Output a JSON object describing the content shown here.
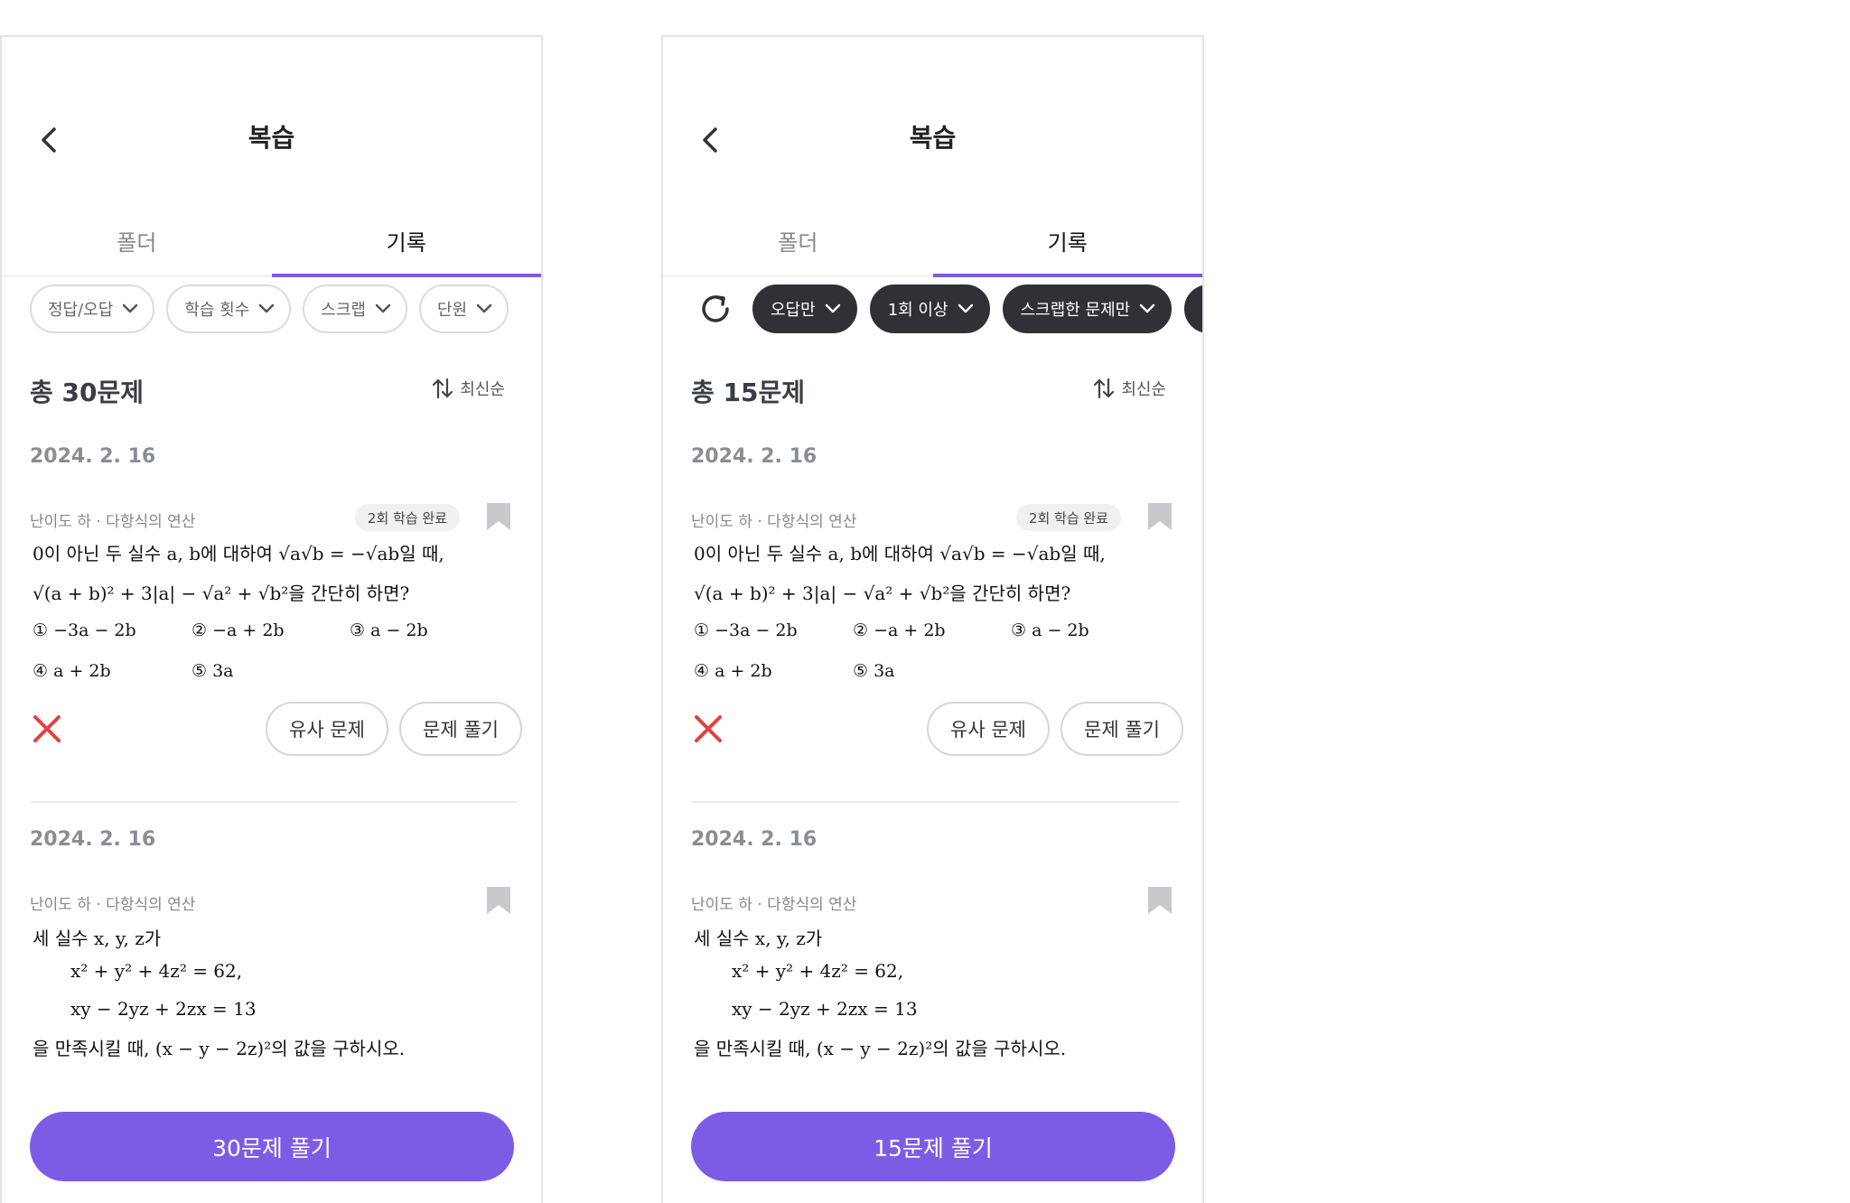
{
  "screens": [
    {
      "title": "복습",
      "tabs": [
        "폴더",
        "기록"
      ],
      "filters": [
        "정답/오답",
        "학습 횟수",
        "스크랩",
        "단원"
      ],
      "total": "총 30문제",
      "sort": "최신순",
      "items": [
        {
          "date": "2024. 2. 16",
          "meta": "난이도 하 · 다항식의 연산",
          "badge": "2회 학습 완료",
          "q_line1": "0이 아닌 두 실수 a, b에 대하여 √a√b = −√ab일 때,",
          "q_line2": "√(a + b)² + 3|a| − √a² + √b²을 간단히 하면?",
          "choices": [
            "① −3a − 2b",
            "② −a + 2b",
            "③ a − 2b",
            "④ a + 2b",
            "⑤ 3a"
          ],
          "similar": "유사 문제",
          "solve": "문제 풀기"
        },
        {
          "date": "2024. 2. 16",
          "meta": "난이도 하 · 다항식의 연산",
          "q_line1": "세 실수 x, y, z가",
          "q_line2": "x² + y² + 4z² = 62,",
          "q_line3": "xy − 2yz + 2zx = 13",
          "q_line4": "을 만족시킬 때, (x − y − 2z)²의 값을 구하시오."
        }
      ],
      "cta": "30문제 풀기"
    },
    {
      "title": "복습",
      "tabs": [
        "폴더",
        "기록"
      ],
      "filters": [
        "오답만",
        "1회 이상",
        "스크랩한 문제만"
      ],
      "total": "총 15문제",
      "sort": "최신순",
      "items": [
        {
          "date": "2024. 2. 16",
          "meta": "난이도 하 · 다항식의 연산",
          "badge": "2회 학습 완료",
          "q_line1": "0이 아닌 두 실수 a, b에 대하여 √a√b = −√ab일 때,",
          "q_line2": "√(a + b)² + 3|a| − √a² + √b²을 간단히 하면?",
          "choices": [
            "① −3a − 2b",
            "② −a + 2b",
            "③ a − 2b",
            "④ a + 2b",
            "⑤ 3a"
          ],
          "similar": "유사 문제",
          "solve": "문제 풀기"
        },
        {
          "date": "2024. 2. 16",
          "meta": "난이도 하 · 다항식의 연산",
          "q_line1": "세 실수 x, y, z가",
          "q_line2": "x² + y² + 4z² = 62,",
          "q_line3": "xy − 2yz + 2zx = 13",
          "q_line4": "을 만족시킬 때, (x − y − 2z)²의 값을 구하시오."
        }
      ],
      "cta": "15문제 풀기"
    }
  ],
  "colors": {
    "accent": "#7d5ce5",
    "chip_dark": "#2f3136",
    "wrong": "#e5403c",
    "bookmark": "#c8c9cd"
  },
  "icons": [
    "back-arrow-icon",
    "chevron-down-icon",
    "sort-icon",
    "bookmark-icon",
    "wrong-x-icon",
    "refresh-icon"
  ]
}
